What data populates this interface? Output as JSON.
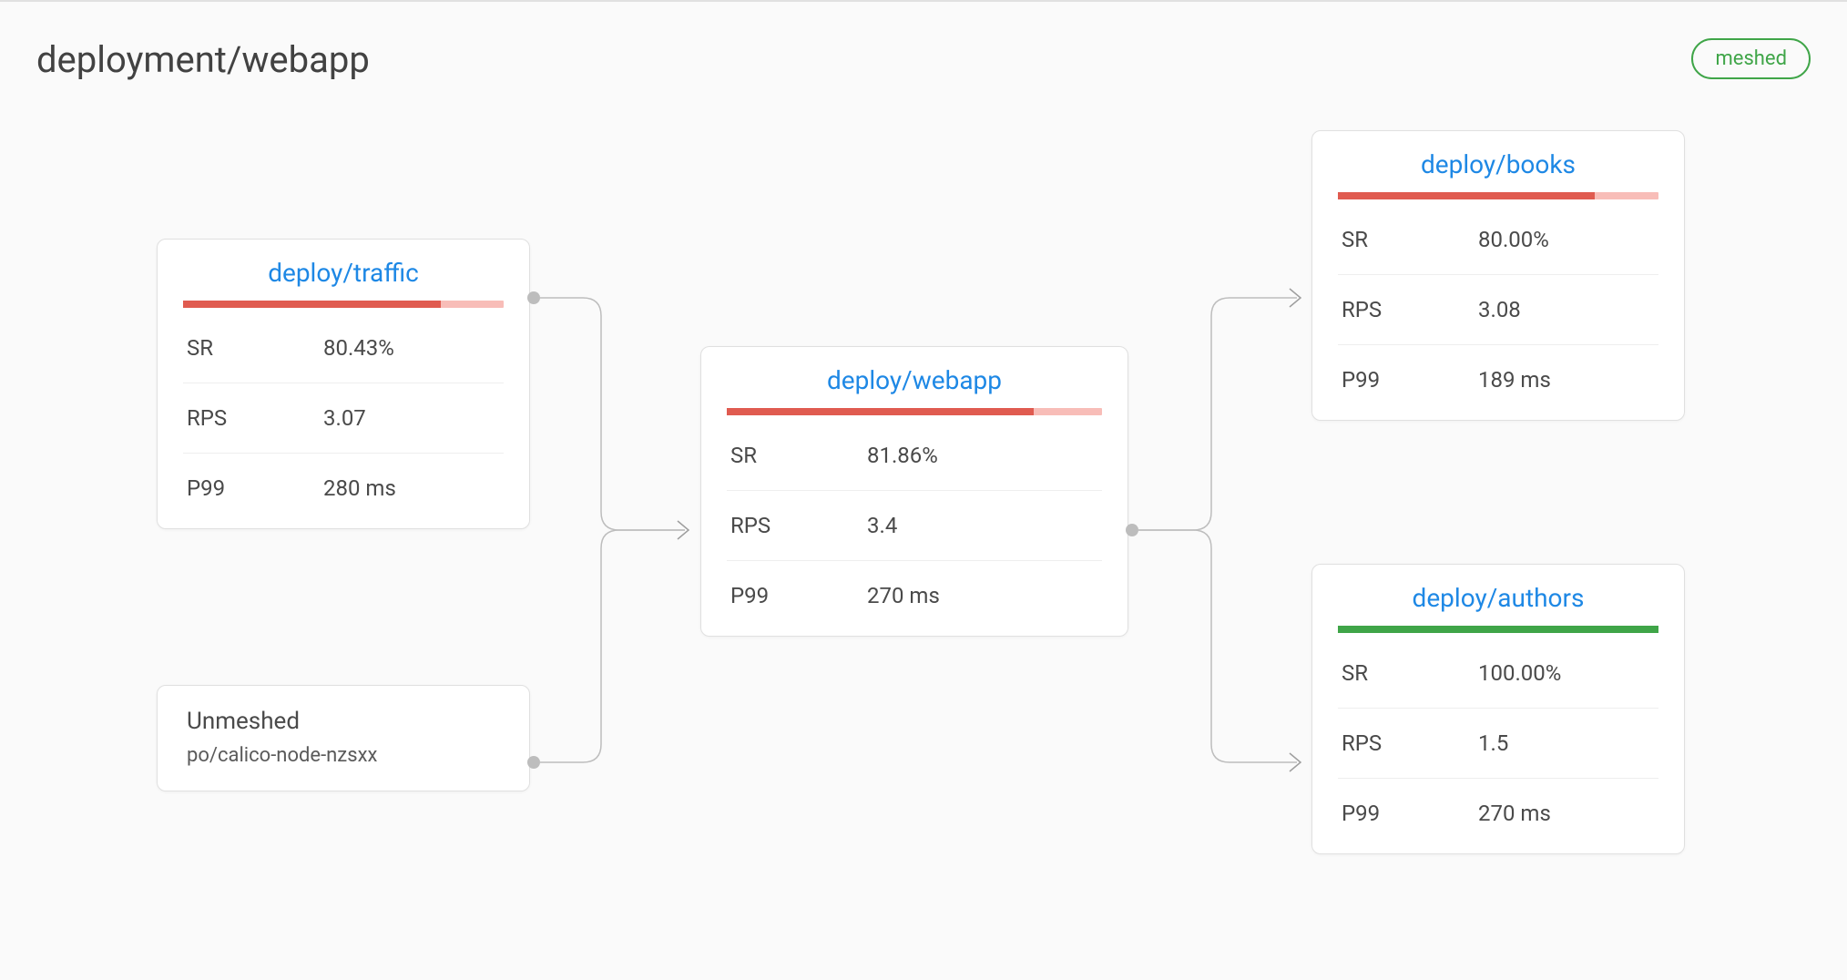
{
  "header": {
    "title": "deployment/webapp",
    "badge": "meshed"
  },
  "labels": {
    "sr": "SR",
    "rps": "RPS",
    "p99": "P99"
  },
  "nodes": {
    "traffic": {
      "title": "deploy/traffic",
      "sr": "80.43%",
      "rps": "3.07",
      "p99": "280 ms",
      "bar_pct": 80.43,
      "bar_color": "red"
    },
    "unmeshed": {
      "title": "Unmeshed",
      "subtitle": "po/calico-node-nzsxx"
    },
    "webapp": {
      "title": "deploy/webapp",
      "sr": "81.86%",
      "rps": "3.4",
      "p99": "270 ms",
      "bar_pct": 81.86,
      "bar_color": "red"
    },
    "books": {
      "title": "deploy/books",
      "sr": "80.00%",
      "rps": "3.08",
      "p99": "189 ms",
      "bar_pct": 80.0,
      "bar_color": "red"
    },
    "authors": {
      "title": "deploy/authors",
      "sr": "100.00%",
      "rps": "1.5",
      "p99": "270 ms",
      "bar_pct": 100.0,
      "bar_color": "green"
    }
  }
}
